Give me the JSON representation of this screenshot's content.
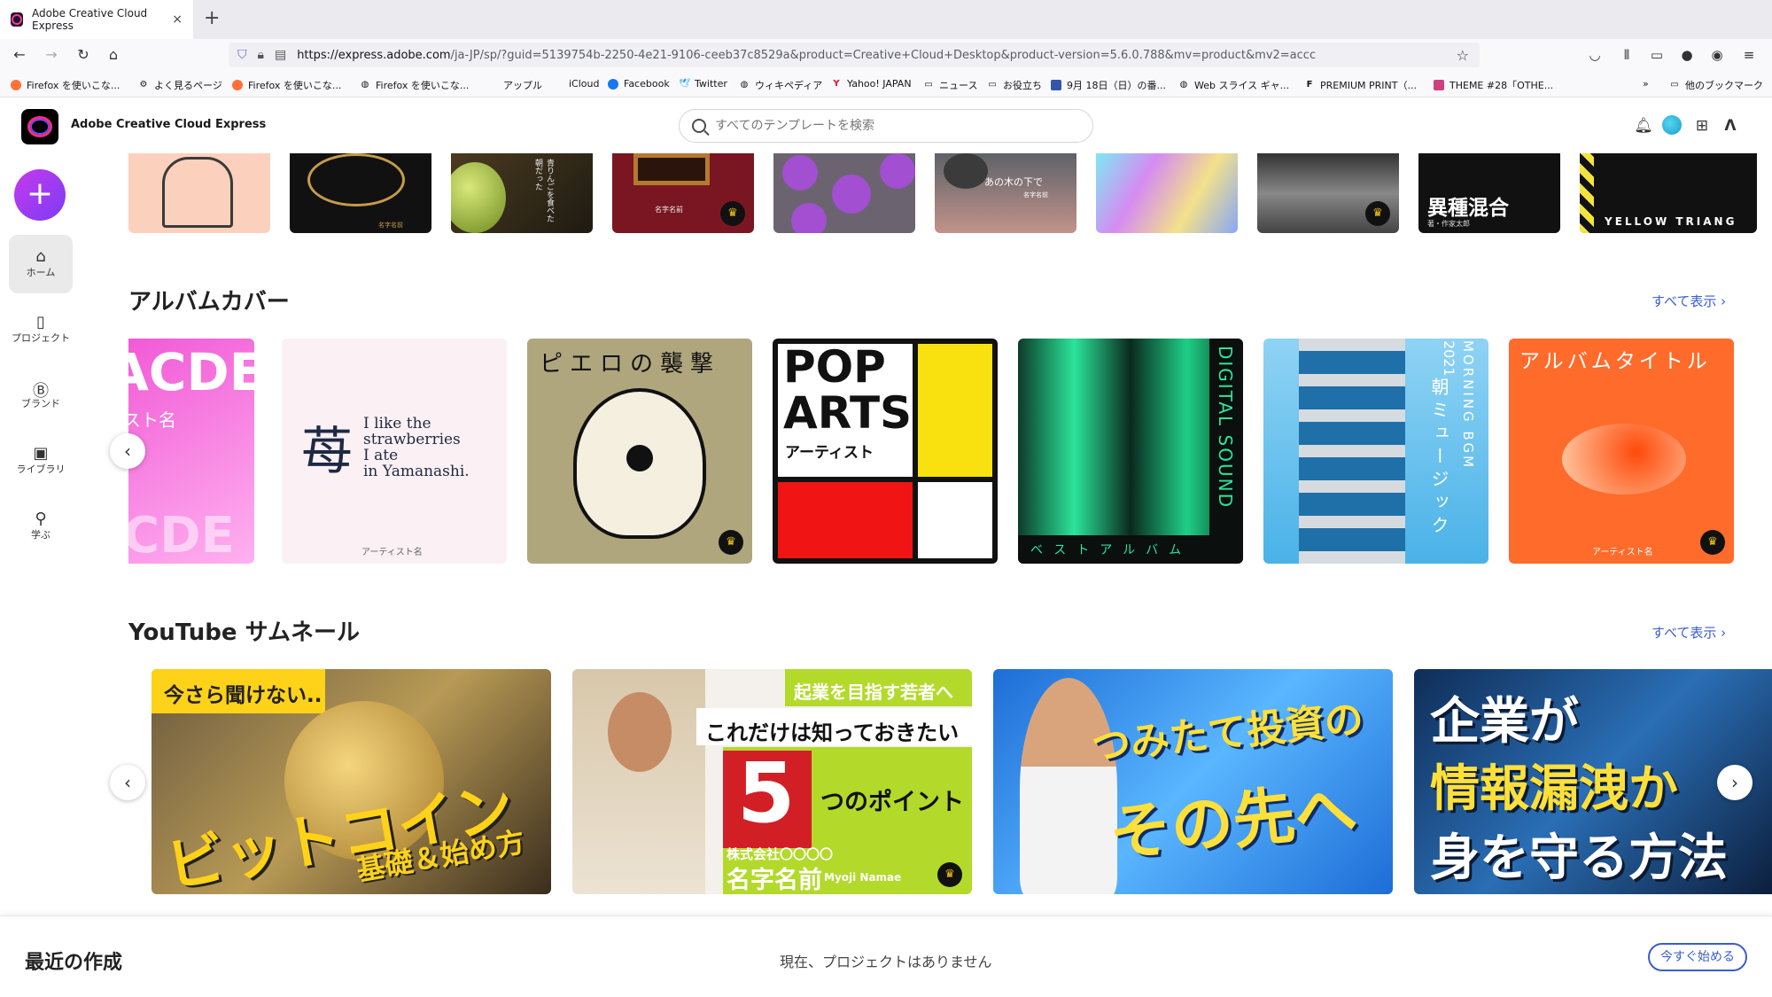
{
  "browser": {
    "tab_title": "Adobe Creative Cloud Express",
    "tab_close": "×",
    "new_tab": "+",
    "url_host": "https://express.adobe.com",
    "url_path": "/ja-JP/sp/?guid=5139754b-2250-4e21-9106-ceeb37c8529a&product=Creative+Cloud+Desktop&product-version=5.6.0.788&mv=product&mv2=accc",
    "bookmarks": [
      "Firefox を使いこな...",
      "よく見るページ",
      "Firefox を使いこな...",
      "Firefox を使いこな...",
      "アップル",
      "iCloud",
      "Facebook",
      "Twitter",
      "ウィキペディア",
      "Yahoo! JAPAN",
      "ニュース",
      "お役立ち",
      "9月 18日（日）の番...",
      "Web スライス ギャ...",
      "PREMIUM PRINT（...",
      "THEME #28「OTHE...",
      "他のブックマーク"
    ]
  },
  "app": {
    "title": "Adobe Creative Cloud Express",
    "search_placeholder": "すべてのテンプレートを検索"
  },
  "sidebar": {
    "create": "+",
    "items": [
      {
        "label": "ホーム"
      },
      {
        "label": "プロジェクト"
      },
      {
        "label": "ブランド"
      },
      {
        "label": "ライブラリ"
      },
      {
        "label": "学ぶ"
      }
    ]
  },
  "top_row": {
    "card2_text": "名字名前",
    "card3_text": "青りんごを食べた朝だった",
    "card4_text": "名字名前",
    "card6_text": "あの木の下で",
    "card6_sub": "名字名前",
    "card9_title": "異種混合",
    "card9_sub": "著・作家太郎",
    "card10_text": "YELLOW TRIANG"
  },
  "albums": {
    "title": "アルバムカバー",
    "see_all": "すべて表示 ›",
    "card1_big": "ACDE",
    "card1_sub": "スト名",
    "card1_bottom": "CDE",
    "card2_kanji": "苺",
    "card2_l1": "I like the",
    "card2_l2": "strawberries",
    "card2_l3": "I ate",
    "card2_l4": "in Yamanashi.",
    "card2_artist": "アーティスト名",
    "card3_title": "ピエロの襲撃",
    "card4_l1": "POP",
    "card4_l2": "ARTS",
    "card4_artist": "アーティスト",
    "card5_side": "DIGITAL SOUND",
    "card5_bottom": "ベストアルバム",
    "card6_v1": "MORNING BGM",
    "card6_v2": "2021",
    "card6_v3": "朝ミュージック",
    "card7_title": "アルバムタイトル",
    "card7_artist": "アーティスト名"
  },
  "youtube": {
    "title": "YouTube サムネール",
    "see_all": "すべて表示 ›",
    "card1_top": "今さら聞けない..",
    "card1_main": "ビットコイン",
    "card1_sub": "基礎＆始め方",
    "card2_top": "起業を目指す若者へ",
    "card2_l2": "これだけは知っておきたい",
    "card2_num": "5",
    "card2_l3": "つのポイント",
    "card2_company": "株式会社〇〇〇〇",
    "card2_name": "名字名前",
    "card2_name_en": "Myoji Namae",
    "card3_l1": "つみたて投資の",
    "card3_l2": "その先へ",
    "card4_l1": "企業が",
    "card4_l2": "情報漏洩か",
    "card4_l3": "身を守る方法"
  },
  "recent": {
    "title": "最近の作成",
    "empty": "現在、プロジェクトはありません",
    "start": "今すぐ始める"
  },
  "icons": {
    "crown": "♛",
    "arrow_left": "‹",
    "arrow_right": "›"
  }
}
